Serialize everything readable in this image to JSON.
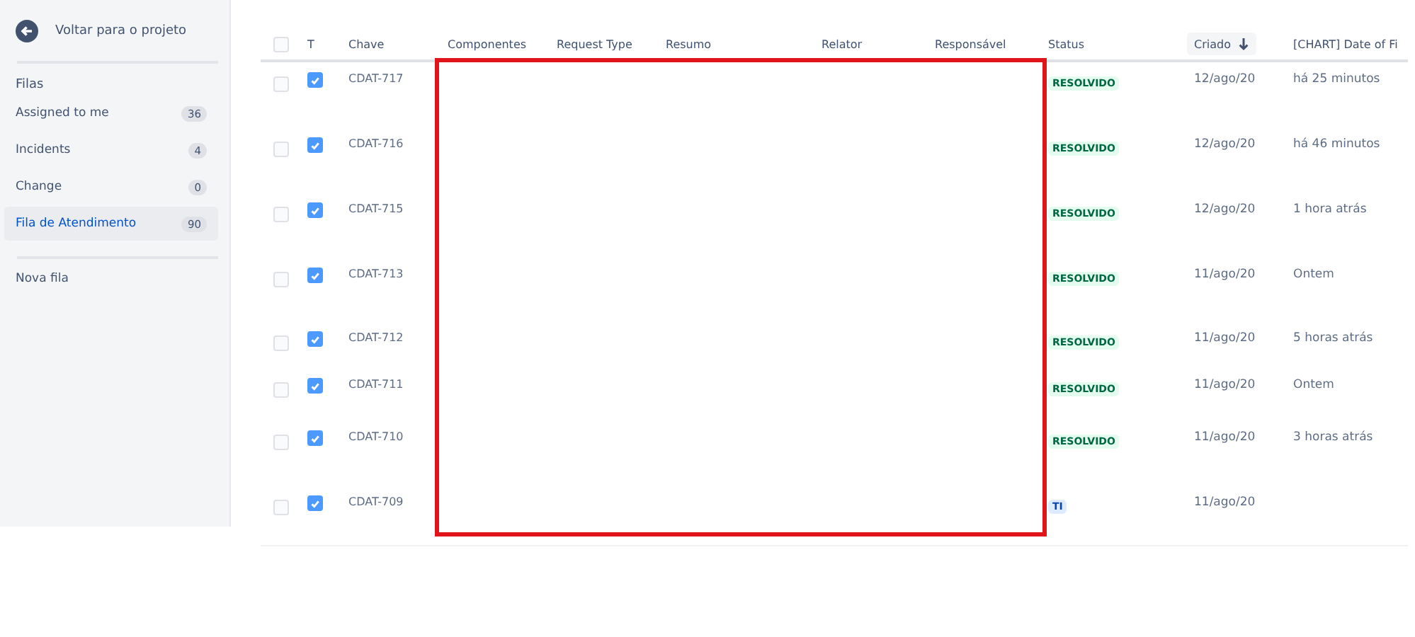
{
  "sidebar": {
    "back_link": "Voltar para o projeto",
    "section_title": "Filas",
    "queues": [
      {
        "label": "Assigned to me",
        "count": "36",
        "selected": false
      },
      {
        "label": "Incidents",
        "count": "4",
        "selected": false
      },
      {
        "label": "Change",
        "count": "0",
        "selected": false
      },
      {
        "label": "Fila de Atendimento",
        "count": "90",
        "selected": true
      }
    ],
    "new_queue": "Nova fila"
  },
  "table": {
    "select_all_checked": false,
    "columns": [
      {
        "label": "T",
        "sorted": false
      },
      {
        "label": "Chave",
        "sorted": false
      },
      {
        "label": "Componentes",
        "sorted": false
      },
      {
        "label": "Request Type",
        "sorted": false
      },
      {
        "label": "Resumo",
        "sorted": false
      },
      {
        "label": "Relator",
        "sorted": false
      },
      {
        "label": "Responsável",
        "sorted": false
      },
      {
        "label": "Status",
        "sorted": false
      },
      {
        "label": "Criado",
        "sorted": true
      },
      {
        "label": "[CHART] Date of Fi",
        "sorted": false
      }
    ],
    "rows": [
      {
        "selected": false,
        "type_checked": true,
        "key": "CDAT-717",
        "status": {
          "label": "RESOLVIDO",
          "kind": "done"
        },
        "created": "12/ago/20",
        "chart_date": "há 25 minutos"
      },
      {
        "selected": false,
        "type_checked": true,
        "key": "CDAT-716",
        "status": {
          "label": "RESOLVIDO",
          "kind": "done"
        },
        "created": "12/ago/20",
        "chart_date": "há 46 minutos"
      },
      {
        "selected": false,
        "type_checked": true,
        "key": "CDAT-715",
        "status": {
          "label": "RESOLVIDO",
          "kind": "done"
        },
        "created": "12/ago/20",
        "chart_date": "1 hora atrás"
      },
      {
        "selected": false,
        "type_checked": true,
        "key": "CDAT-713",
        "status": {
          "label": "RESOLVIDO",
          "kind": "done"
        },
        "created": "11/ago/20",
        "chart_date": "Ontem"
      },
      {
        "selected": false,
        "type_checked": true,
        "key": "CDAT-712",
        "status": {
          "label": "RESOLVIDO",
          "kind": "done"
        },
        "created": "11/ago/20",
        "chart_date": "5 horas atrás"
      },
      {
        "selected": false,
        "type_checked": true,
        "key": "CDAT-711",
        "status": {
          "label": "RESOLVIDO",
          "kind": "done"
        },
        "created": "11/ago/20",
        "chart_date": "Ontem"
      },
      {
        "selected": false,
        "type_checked": true,
        "key": "CDAT-710",
        "status": {
          "label": "RESOLVIDO",
          "kind": "done"
        },
        "created": "11/ago/20",
        "chart_date": "3 horas atrás"
      },
      {
        "selected": false,
        "type_checked": true,
        "key": "CDAT-709",
        "status": {
          "label": "TI",
          "kind": "in_progress"
        },
        "created": "11/ago/20"
      }
    ]
  }
}
